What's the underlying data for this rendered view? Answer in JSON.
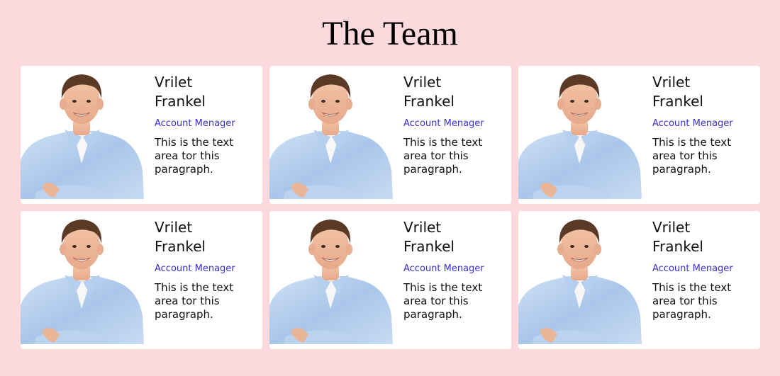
{
  "page": {
    "title": "The Team"
  },
  "colors": {
    "background": "#fbd9dc",
    "card": "#ffffff",
    "role_text": "#3a2fd0"
  },
  "team": [
    {
      "name_first": "Vrilet",
      "name_last": "Frankel",
      "role": "Account Menager",
      "description": "This is the text area tor this paragraph.",
      "photo_icon": "person-photo"
    },
    {
      "name_first": "Vrilet",
      "name_last": "Frankel",
      "role": "Account Menager",
      "description": "This is the text area tor this paragraph.",
      "photo_icon": "person-photo"
    },
    {
      "name_first": "Vrilet",
      "name_last": "Frankel",
      "role": "Account Menager",
      "description": "This is the text area tor this paragraph.",
      "photo_icon": "person-photo"
    },
    {
      "name_first": "Vrilet",
      "name_last": "Frankel",
      "role": "Account Menager",
      "description": "This is the text area tor this paragraph.",
      "photo_icon": "person-photo"
    },
    {
      "name_first": "Vrilet",
      "name_last": "Frankel",
      "role": "Account Menager",
      "description": "This is the text area tor this paragraph.",
      "photo_icon": "person-photo"
    },
    {
      "name_first": "Vrilet",
      "name_last": "Frankel",
      "role": "Account Menager",
      "description": "This is the text area tor this paragraph.",
      "photo_icon": "person-photo"
    }
  ]
}
